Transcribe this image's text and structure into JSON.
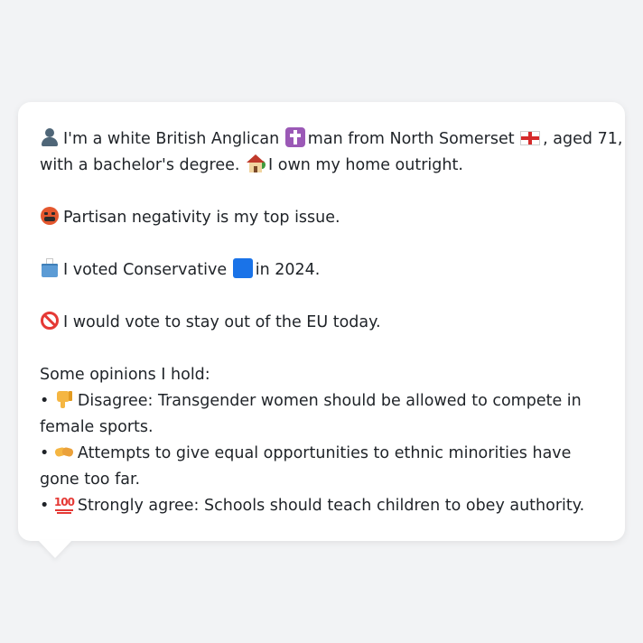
{
  "profile": {
    "line1_a": "I'm a white British Anglican",
    "line1_b": "man from North Somerset",
    "line1_c": ", aged 71,",
    "line2_a": "with a bachelor's degree.",
    "line2_b": "I own my home outright.",
    "top_issue": "Partisan negativity is my top issue.",
    "vote_a": "I voted Conservative",
    "vote_b": "in 2024.",
    "eu": "I would vote to stay out of the EU today.",
    "opinions_heading": "Some opinions I hold:",
    "opinions": [
      {
        "bullet": "•",
        "text": "Disagree: Transgender women should be allowed to compete in female sports."
      },
      {
        "bullet": "•",
        "text": "Attempts to give equal opportunities to ethnic minorities have gone too far."
      },
      {
        "bullet": "•",
        "text": "Strongly agree: Schools should teach children to obey authority."
      }
    ]
  },
  "icons": {
    "person": "person-icon",
    "religion": "latin-cross-icon",
    "region": "england-flag-icon",
    "home": "house-icon",
    "issue": "angry-face-icon",
    "vote": "ballot-box-icon",
    "party": "blue-square-icon",
    "eu": "prohibited-icon",
    "opinion1": "thumbs-down-icon",
    "opinion2": "handshake-icon",
    "opinion3": "hundred-points-icon",
    "hundred_text": "100"
  },
  "colors": {
    "background": "#f2f3f5",
    "card": "#ffffff",
    "text": "#1f2328"
  }
}
